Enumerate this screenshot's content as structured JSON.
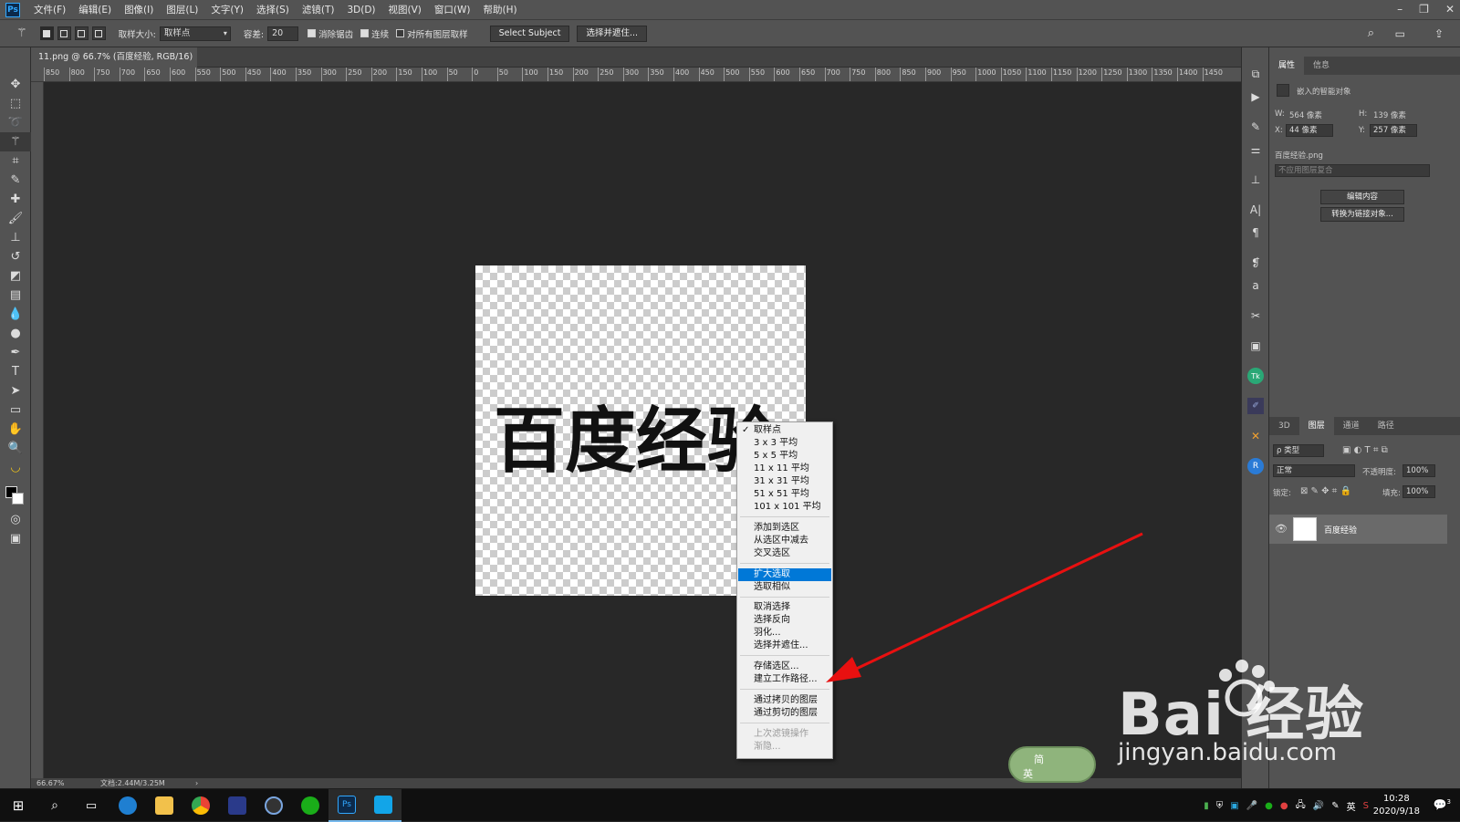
{
  "app": {
    "logo": "Ps"
  },
  "menubar": {
    "items": [
      "文件(F)",
      "编辑(E)",
      "图像(I)",
      "图层(L)",
      "文字(Y)",
      "选择(S)",
      "滤镜(T)",
      "3D(D)",
      "视图(V)",
      "窗口(W)",
      "帮助(H)"
    ]
  },
  "options": {
    "sample_size_label": "取样大小:",
    "sample_size_value": "取样点",
    "tolerance_label": "容差:",
    "tolerance_value": "20",
    "antialias_label": "消除锯齿",
    "contiguous_label": "连续",
    "all_layers_label": "对所有图层取样",
    "select_subject": "Select Subject",
    "select_mask": "选择并遮住..."
  },
  "document": {
    "tab_title": "11.png @ 66.7% (百度经验, RGB/16) *",
    "canvas_text": "百度经验"
  },
  "ruler": {
    "labels": [
      "850",
      "800",
      "750",
      "700",
      "650",
      "600",
      "550",
      "500",
      "450",
      "400",
      "350",
      "300",
      "250",
      "200",
      "150",
      "100",
      "50",
      "0",
      "50",
      "100",
      "150",
      "200",
      "250",
      "300",
      "350",
      "400",
      "450",
      "500",
      "550",
      "600",
      "650",
      "700",
      "750",
      "800",
      "850",
      "900",
      "950",
      "1000",
      "1050",
      "1100",
      "1150",
      "1200",
      "1250",
      "1300",
      "1350",
      "1400",
      "1450"
    ]
  },
  "status": {
    "zoom": "66.67%",
    "doc_size": "文档:2.44M/3.25M"
  },
  "context_menu": {
    "group1": [
      "取样点",
      "3 x 3 平均",
      "5 x 5 平均",
      "11 x 11 平均",
      "31 x 31 平均",
      "51 x 51 平均",
      "101 x 101 平均"
    ],
    "group2": [
      "添加到选区",
      "从选区中减去",
      "交叉选区"
    ],
    "group3": [
      "扩大选取",
      "选取相似"
    ],
    "group4": [
      "取消选择",
      "选择反向",
      "羽化...",
      "选择并遮住..."
    ],
    "group5": [
      "存储选区...",
      "建立工作路径..."
    ],
    "group6": [
      "通过拷贝的图层",
      "通过剪切的图层"
    ],
    "group7": [
      "上次滤镜操作",
      "渐隐..."
    ]
  },
  "properties": {
    "tabs": [
      "属性",
      "信息"
    ],
    "object_type": "嵌入的智能对象",
    "w_label": "W:",
    "w_value": "564 像素",
    "h_label": "H:",
    "h_value": "139 像素",
    "x_label": "X:",
    "x_value": "44 像素",
    "y_label": "Y:",
    "y_value": "257 像素",
    "filename": "百度经验.png",
    "comp_placeholder": "不应用图层复合",
    "edit_btn": "编辑内容",
    "convert_btn": "转换为链接对象..."
  },
  "layers": {
    "tabs": [
      "3D",
      "图层",
      "通道",
      "路径"
    ],
    "filter_label": "ρ 类型",
    "blend_mode": "正常",
    "opacity_label": "不透明度:",
    "opacity_value": "100%",
    "lock_label": "锁定:",
    "fill_label": "填充:",
    "fill_value": "100%",
    "layer_name": "百度经验"
  },
  "taskbar": {
    "time": "10:28",
    "date": "2020/9/18",
    "ime": "英",
    "notif": "3"
  },
  "watermark": {
    "brand": "Bai  经验",
    "url": "jingyan.baidu.com",
    "badge_top": "简",
    "badge_bottom": "英"
  },
  "colors": {
    "accent": "#0078d7",
    "ps_blue": "#31a8ff",
    "arrow": "#e81010"
  }
}
